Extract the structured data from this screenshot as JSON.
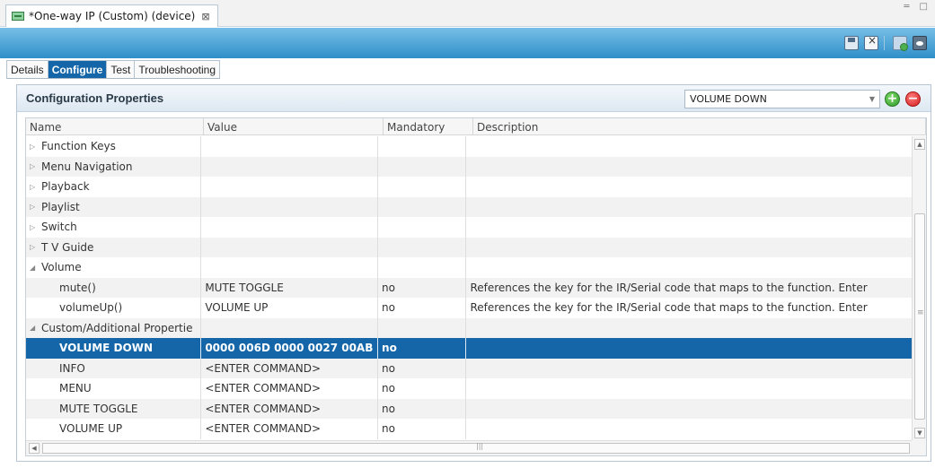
{
  "editor_tab": {
    "title": "*One-way IP (Custom) (device)",
    "close_glyph": "⊠"
  },
  "window_controls": {
    "glyphs": "═ □"
  },
  "subtabs": [
    "Details",
    "Configure",
    "Test",
    "Troubleshooting"
  ],
  "active_subtab": "Configure",
  "panel": {
    "title": "Configuration Properties",
    "key_select_value": "VOLUME DOWN",
    "add_glyph": "+",
    "remove_glyph": "−"
  },
  "columns": [
    "Name",
    "Value",
    "Mandatory",
    "Description"
  ],
  "rows": [
    {
      "name": "Function Keys",
      "value": "",
      "mandatory": "",
      "description": "",
      "toggle": "▷",
      "level": 0
    },
    {
      "name": "Menu Navigation",
      "value": "",
      "mandatory": "",
      "description": "",
      "toggle": "▷",
      "level": 0
    },
    {
      "name": "Playback",
      "value": "",
      "mandatory": "",
      "description": "",
      "toggle": "▷",
      "level": 0
    },
    {
      "name": "Playlist",
      "value": "",
      "mandatory": "",
      "description": "",
      "toggle": "▷",
      "level": 0
    },
    {
      "name": "Switch",
      "value": "",
      "mandatory": "",
      "description": "",
      "toggle": "▷",
      "level": 0
    },
    {
      "name": "T V Guide",
      "value": "",
      "mandatory": "",
      "description": "",
      "toggle": "▷",
      "level": 0
    },
    {
      "name": "Volume",
      "value": "",
      "mandatory": "",
      "description": "",
      "toggle": "◢",
      "level": 0
    },
    {
      "name": "mute()",
      "value": "MUTE TOGGLE",
      "mandatory": "no",
      "description": "References the key for the IR/Serial code that maps to the function. Enter",
      "toggle": "",
      "level": 1
    },
    {
      "name": "volumeUp()",
      "value": "VOLUME UP",
      "mandatory": "no",
      "description": "References the key for the IR/Serial code that maps to the function. Enter",
      "toggle": "",
      "level": 1
    },
    {
      "name": "Custom/Additional Propertie",
      "value": "",
      "mandatory": "",
      "description": "",
      "toggle": "◢",
      "level": 0
    },
    {
      "name": "VOLUME DOWN",
      "value": "0000 006D 0000 0027 00AB",
      "mandatory": "no",
      "description": "",
      "toggle": "",
      "level": 1,
      "selected": true
    },
    {
      "name": "INFO",
      "value": "<ENTER COMMAND>",
      "mandatory": "no",
      "description": "",
      "toggle": "",
      "level": 1
    },
    {
      "name": "MENU",
      "value": "<ENTER COMMAND>",
      "mandatory": "no",
      "description": "",
      "toggle": "",
      "level": 1
    },
    {
      "name": "MUTE TOGGLE",
      "value": "<ENTER COMMAND>",
      "mandatory": "no",
      "description": "",
      "toggle": "",
      "level": 1
    },
    {
      "name": "VOLUME UP",
      "value": "<ENTER COMMAND>",
      "mandatory": "no",
      "description": "",
      "toggle": "",
      "level": 1
    }
  ],
  "scroll_glyphs": {
    "up": "▲",
    "down": "▼",
    "left": "◀",
    "right": "▶"
  },
  "colors": {
    "toolbar": "#2f8fc9",
    "selection": "#1466a9",
    "active_tab": "#1466a9",
    "add": "#2f9a2a",
    "remove": "#d32020"
  }
}
